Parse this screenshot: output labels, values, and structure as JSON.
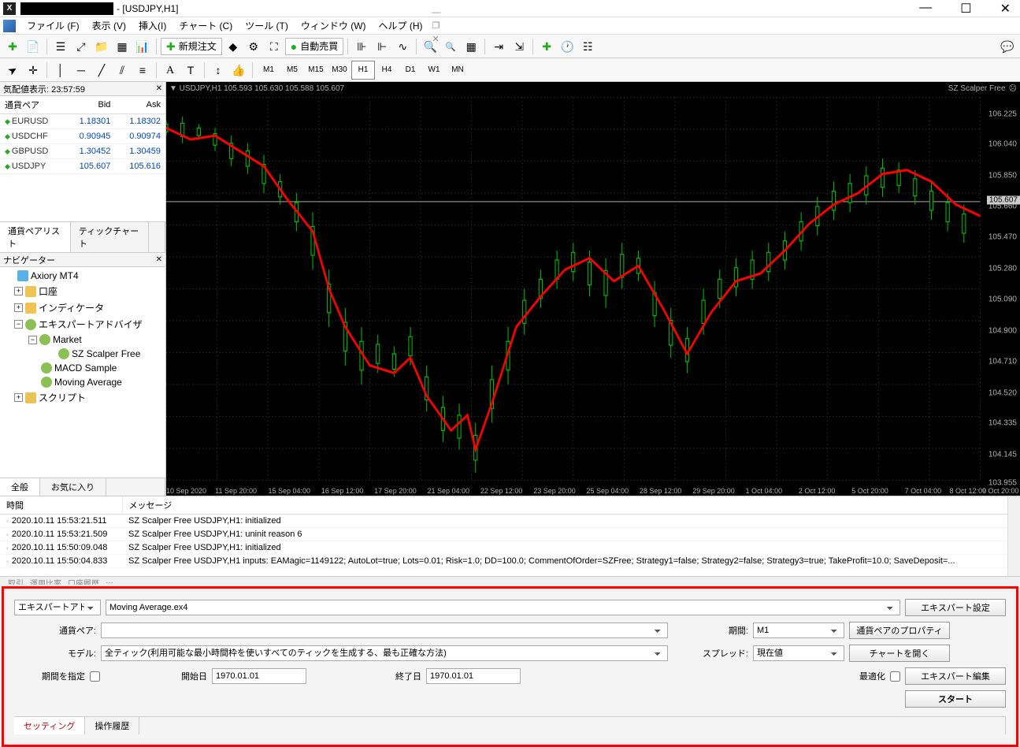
{
  "titlebar": {
    "app_suffix": "- [USDJPY,H1]"
  },
  "menu": {
    "file": "ファイル (F)",
    "view": "表示 (V)",
    "insert": "挿入(I)",
    "chart": "チャート (C)",
    "tool": "ツール (T)",
    "window": "ウィンドウ (W)",
    "help": "ヘルプ (H)"
  },
  "toolbar1": {
    "new_order": "新規注文",
    "auto_trade": "自動売買"
  },
  "timeframes": [
    "M1",
    "M5",
    "M15",
    "M30",
    "H1",
    "H4",
    "D1",
    "W1",
    "MN"
  ],
  "timeframe_active": "H1",
  "market_watch": {
    "title": "気配値表示: 23:57:59",
    "cols": {
      "sym": "通貨ペア",
      "bid": "Bid",
      "ask": "Ask"
    },
    "rows": [
      {
        "sym": "EURUSD",
        "bid": "1.18301",
        "ask": "1.18302"
      },
      {
        "sym": "USDCHF",
        "bid": "0.90945",
        "ask": "0.90974"
      },
      {
        "sym": "GBPUSD",
        "bid": "1.30452",
        "ask": "1.30459"
      },
      {
        "sym": "USDJPY",
        "bid": "105.607",
        "ask": "105.616"
      }
    ],
    "tabs": {
      "list": "通貨ペアリスト",
      "tick": "ティックチャート"
    }
  },
  "navigator": {
    "title": "ナビゲーター",
    "root": "Axiory MT4",
    "account": "口座",
    "indicator": "インディケータ",
    "ea": "エキスパートアドバイザ",
    "market": "Market",
    "sz": "SZ Scalper Free",
    "macd": "MACD Sample",
    "ma": "Moving Average",
    "script": "スクリプト",
    "tabs": {
      "general": "全般",
      "fav": "お気に入り"
    }
  },
  "chart": {
    "header_left": "▼ USDJPY,H1  105.593 105.630 105.588 105.607",
    "ea_label": "SZ Scalper Free",
    "current_price": "105.607",
    "ylabels": [
      {
        "v": "106.225",
        "p": 5
      },
      {
        "v": "106.040",
        "p": 12.8
      },
      {
        "v": "105.850",
        "p": 20.8
      },
      {
        "v": "105.660",
        "p": 28.8
      },
      {
        "v": "105.470",
        "p": 36.8
      },
      {
        "v": "105.280",
        "p": 44.8
      },
      {
        "v": "105.090",
        "p": 52.8
      },
      {
        "v": "104.900",
        "p": 60.8
      },
      {
        "v": "104.710",
        "p": 68.8
      },
      {
        "v": "104.520",
        "p": 76.8
      },
      {
        "v": "104.335",
        "p": 84.6
      },
      {
        "v": "104.145",
        "p": 92.6
      },
      {
        "v": "103.955",
        "p": 100
      }
    ],
    "xlabels": [
      {
        "t": "10 Sep 2020",
        "p": 0
      },
      {
        "t": "11 Sep 20:00",
        "p": 6
      },
      {
        "t": "15 Sep 04:00",
        "p": 12.5
      },
      {
        "t": "16 Sep 12:00",
        "p": 19
      },
      {
        "t": "17 Sep 20:00",
        "p": 25.5
      },
      {
        "t": "21 Sep 04:00",
        "p": 32
      },
      {
        "t": "22 Sep 12:00",
        "p": 38.5
      },
      {
        "t": "23 Sep 20:00",
        "p": 45
      },
      {
        "t": "25 Sep 04:00",
        "p": 51.5
      },
      {
        "t": "28 Sep 12:00",
        "p": 58
      },
      {
        "t": "29 Sep 20:00",
        "p": 64.5
      },
      {
        "t": "1 Oct 04:00",
        "p": 71
      },
      {
        "t": "2 Oct 12:00",
        "p": 77.5
      },
      {
        "t": "5 Oct 20:00",
        "p": 84
      },
      {
        "t": "7 Oct 04:00",
        "p": 90.5
      },
      {
        "t": "8 Oct 12:00",
        "p": 96
      },
      {
        "t": "9 Oct 20:00",
        "p": 100
      }
    ]
  },
  "terminal": {
    "cols": {
      "time": "時間",
      "msg": "メッセージ"
    },
    "rows": [
      {
        "time": "2020.10.11 15:53:21.511",
        "msg": "SZ Scalper Free USDJPY,H1: initialized"
      },
      {
        "time": "2020.10.11 15:53:21.509",
        "msg": "SZ Scalper Free USDJPY,H1: uninit reason 6"
      },
      {
        "time": "2020.10.11 15:50:09.048",
        "msg": "SZ Scalper Free USDJPY,H1: initialized"
      },
      {
        "time": "2020.10.11 15:50:04.833",
        "msg": "SZ Scalper Free USDJPY,H1 inputs: EAMagic=1149122; AutoLot=true; Lots=0.01; Risk=1.0; DD=100.0; CommentOfOrder=SZFree; Strategy1=false; Strategy2=false; Strategy3=true; TakeProfit=10.0; SaveDeposit=..."
      }
    ]
  },
  "tester": {
    "ea_dd_label": "エキスパートアドバイザ",
    "ea_value": "Moving Average.ex4",
    "symbol_label": "通貨ペア:",
    "symbol_value": "",
    "period_label": "期間:",
    "period_value": "M1",
    "model_label": "モデル:",
    "model_value": "全ティック(利用可能な最小時間枠を使いすべてのティックを生成する、最も正確な方法)",
    "spread_label": "スプレッド:",
    "spread_value": "現在値",
    "date_check": "期間を指定",
    "from_label": "開始日",
    "from_value": "1970.01.01",
    "to_label": "終了日",
    "to_value": "1970.01.01",
    "opt_label": "最適化",
    "btn_expert_props": "エキスパート設定",
    "btn_symbol_props": "通貨ペアのプロパティ",
    "btn_open_chart": "チャートを開く",
    "btn_modify": "エキスパート編集",
    "btn_start": "スタート",
    "tabs": {
      "setting": "セッティング",
      "journal": "操作履歴"
    }
  },
  "chart_data": {
    "type": "candlestick",
    "symbol": "USDJPY",
    "timeframe": "H1",
    "ohlc_header": [
      105.593,
      105.63,
      105.588,
      105.607
    ],
    "y_range": [
      103.955,
      106.225
    ],
    "current_price": 105.607,
    "indicator": {
      "name": "Moving Average",
      "color": "#ff0000",
      "width": 2
    },
    "ea_overlay": "SZ Scalper Free",
    "approx_ma_path_pct": [
      [
        0,
        8
      ],
      [
        3,
        11
      ],
      [
        6,
        10
      ],
      [
        9,
        14
      ],
      [
        12,
        18
      ],
      [
        15,
        27
      ],
      [
        18,
        35
      ],
      [
        20,
        50
      ],
      [
        22,
        60
      ],
      [
        25,
        70
      ],
      [
        28,
        72
      ],
      [
        30,
        68
      ],
      [
        32,
        78
      ],
      [
        35,
        87
      ],
      [
        37,
        83
      ],
      [
        38,
        92
      ],
      [
        40,
        80
      ],
      [
        43,
        60
      ],
      [
        46,
        52
      ],
      [
        49,
        45
      ],
      [
        52,
        42
      ],
      [
        55,
        48
      ],
      [
        58,
        44
      ],
      [
        61,
        55
      ],
      [
        64,
        67
      ],
      [
        67,
        56
      ],
      [
        70,
        48
      ],
      [
        73,
        46
      ],
      [
        76,
        40
      ],
      [
        79,
        33
      ],
      [
        82,
        28
      ],
      [
        85,
        25
      ],
      [
        88,
        20
      ],
      [
        91,
        19
      ],
      [
        94,
        22
      ],
      [
        97,
        28
      ],
      [
        100,
        31
      ]
    ],
    "approx_candles_pct": [
      [
        0,
        6,
        10
      ],
      [
        2,
        5,
        12
      ],
      [
        4,
        7,
        11
      ],
      [
        6,
        8,
        14
      ],
      [
        8,
        10,
        18
      ],
      [
        10,
        12,
        20
      ],
      [
        12,
        15,
        25
      ],
      [
        14,
        20,
        28
      ],
      [
        16,
        25,
        35
      ],
      [
        18,
        30,
        45
      ],
      [
        20,
        45,
        60
      ],
      [
        22,
        55,
        70
      ],
      [
        24,
        60,
        75
      ],
      [
        26,
        62,
        72
      ],
      [
        28,
        65,
        73
      ],
      [
        30,
        60,
        70
      ],
      [
        32,
        70,
        82
      ],
      [
        34,
        78,
        90
      ],
      [
        36,
        80,
        92
      ],
      [
        38,
        85,
        98
      ],
      [
        40,
        70,
        85
      ],
      [
        42,
        60,
        75
      ],
      [
        44,
        50,
        62
      ],
      [
        46,
        45,
        55
      ],
      [
        48,
        40,
        50
      ],
      [
        50,
        38,
        48
      ],
      [
        52,
        40,
        52
      ],
      [
        54,
        42,
        55
      ],
      [
        56,
        38,
        50
      ],
      [
        58,
        40,
        48
      ],
      [
        60,
        48,
        60
      ],
      [
        62,
        55,
        68
      ],
      [
        64,
        60,
        72
      ],
      [
        66,
        50,
        62
      ],
      [
        68,
        45,
        55
      ],
      [
        70,
        42,
        52
      ],
      [
        72,
        40,
        50
      ],
      [
        74,
        38,
        48
      ],
      [
        76,
        35,
        45
      ],
      [
        78,
        30,
        40
      ],
      [
        80,
        26,
        36
      ],
      [
        82,
        22,
        32
      ],
      [
        84,
        20,
        30
      ],
      [
        86,
        18,
        28
      ],
      [
        88,
        16,
        26
      ],
      [
        90,
        17,
        25
      ],
      [
        92,
        19,
        28
      ],
      [
        94,
        22,
        32
      ],
      [
        96,
        25,
        35
      ],
      [
        98,
        28,
        38
      ]
    ]
  }
}
